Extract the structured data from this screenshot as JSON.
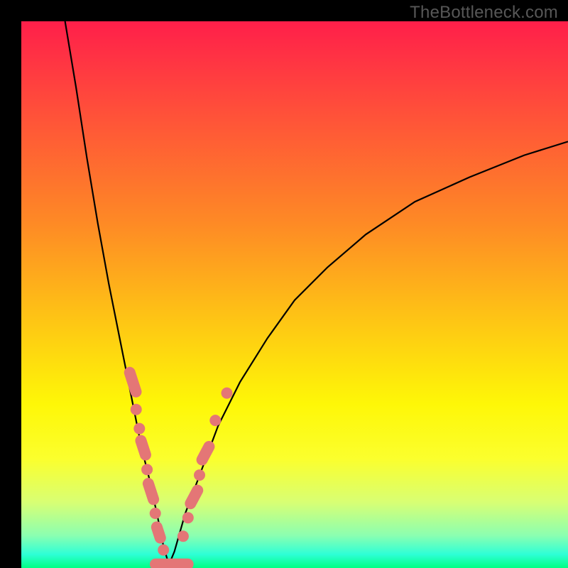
{
  "watermark": "TheBottleneck.com",
  "colors": {
    "frame_bg": "#000000",
    "marker": "#e47676",
    "curve": "#000000",
    "gradient_top": "#ff1f4a",
    "gradient_bottom": "#00ff84"
  },
  "chart_data": {
    "type": "line",
    "title": "",
    "subtitle": "",
    "xlabel": "",
    "ylabel": "",
    "xlim": [
      0,
      100
    ],
    "ylim": [
      0,
      100
    ],
    "notes": "Bottleneck-style V-curve on color gradient; no axes, ticks, or legend visible. Values are approximate pixel-space readouts normalized to 0-100. Pink markers cluster along the two arms near the trough.",
    "series": [
      {
        "name": "curve-left-arm",
        "x": [
          8,
          10,
          12,
          14,
          16,
          18,
          20,
          22,
          23.5,
          25,
          26,
          27
        ],
        "y": [
          100,
          88,
          75,
          63,
          52,
          42,
          32,
          22,
          16,
          9,
          4,
          0.6
        ]
      },
      {
        "name": "curve-right-arm",
        "x": [
          27,
          28,
          30,
          33,
          36,
          40,
          45,
          50,
          56,
          63,
          72,
          82,
          92,
          100
        ],
        "y": [
          0.6,
          3,
          10,
          18,
          26,
          34,
          42,
          49,
          55,
          61,
          67,
          71.5,
          75.5,
          78
        ]
      }
    ],
    "markers": [
      {
        "shape": "pill",
        "arm": "left",
        "x": 20.4,
        "y": 34.0,
        "len": 3.6
      },
      {
        "shape": "dot",
        "arm": "left",
        "x": 21.0,
        "y": 29.0
      },
      {
        "shape": "dot",
        "arm": "left",
        "x": 21.6,
        "y": 25.5
      },
      {
        "shape": "pill",
        "arm": "left",
        "x": 22.3,
        "y": 22.0,
        "len": 3.0
      },
      {
        "shape": "dot",
        "arm": "left",
        "x": 23.0,
        "y": 18.0
      },
      {
        "shape": "pill",
        "arm": "left",
        "x": 23.7,
        "y": 14.0,
        "len": 3.2
      },
      {
        "shape": "dot",
        "arm": "left",
        "x": 24.5,
        "y": 10.0
      },
      {
        "shape": "pill",
        "arm": "left",
        "x": 25.1,
        "y": 6.5,
        "len": 2.6
      },
      {
        "shape": "dot",
        "arm": "left",
        "x": 26.0,
        "y": 3.3
      },
      {
        "shape": "pill",
        "arm": "trough",
        "x": 27.5,
        "y": 0.7,
        "len": 5.0
      },
      {
        "shape": "dot",
        "arm": "right",
        "x": 29.6,
        "y": 5.8
      },
      {
        "shape": "dot",
        "arm": "right",
        "x": 30.5,
        "y": 9.2
      },
      {
        "shape": "pill",
        "arm": "right",
        "x": 31.6,
        "y": 13.0,
        "len": 3.0
      },
      {
        "shape": "dot",
        "arm": "right",
        "x": 32.6,
        "y": 17.0
      },
      {
        "shape": "pill",
        "arm": "right",
        "x": 33.7,
        "y": 21.0,
        "len": 3.0
      },
      {
        "shape": "dot",
        "arm": "right",
        "x": 35.5,
        "y": 27.0
      },
      {
        "shape": "dot",
        "arm": "right",
        "x": 37.6,
        "y": 32.0
      }
    ]
  }
}
